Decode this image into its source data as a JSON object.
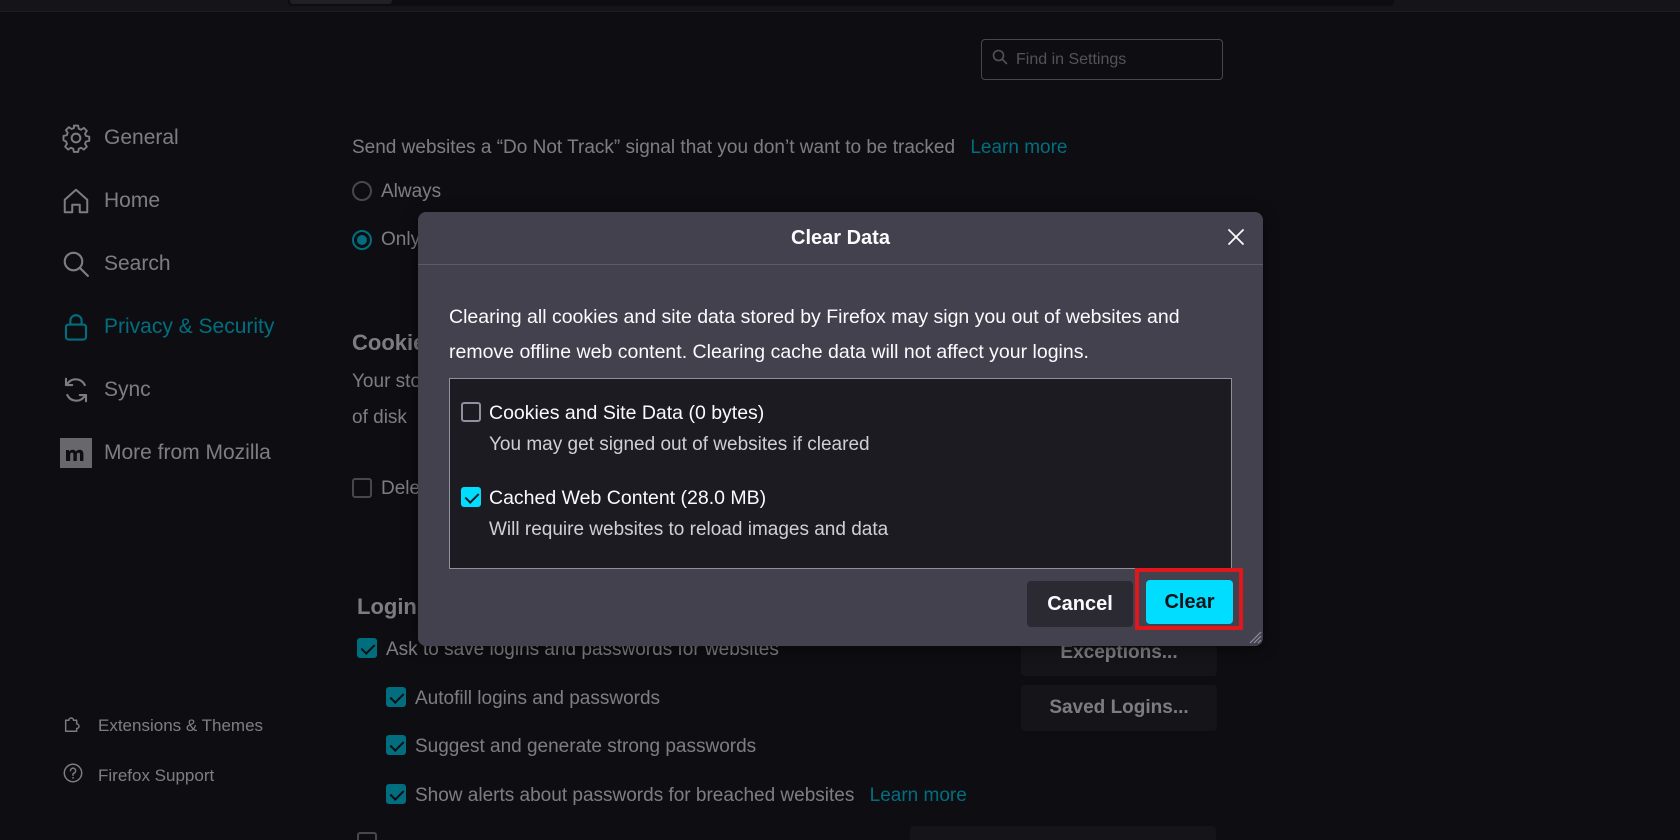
{
  "search": {
    "placeholder": "Find in Settings"
  },
  "sidebar": {
    "items": [
      {
        "label": "General",
        "icon": "gear-icon"
      },
      {
        "label": "Home",
        "icon": "home-icon"
      },
      {
        "label": "Search",
        "icon": "search-icon"
      },
      {
        "label": "Privacy & Security",
        "icon": "lock-icon",
        "active": true
      },
      {
        "label": "Sync",
        "icon": "sync-icon"
      },
      {
        "label": "More from Mozilla",
        "icon": "mozilla-icon"
      }
    ],
    "footer": [
      {
        "label": "Extensions & Themes",
        "icon": "puzzle-icon"
      },
      {
        "label": "Firefox Support",
        "icon": "help-icon"
      }
    ]
  },
  "main": {
    "dnt_text": "Send websites a “Do Not Track” signal that you don’t want to be tracked",
    "dnt_learn_more": "Learn more",
    "dnt_always": "Always",
    "dnt_only": "Only",
    "cookies_heading": "Cookie",
    "cookies_text1": "Your sto",
    "cookies_text2": "of disk",
    "delete_label": "Dele",
    "logins_heading": "Logins",
    "ask_save": "Ask to save logins and passwords for websites",
    "autofill": "Autofill logins and passwords",
    "suggest": "Suggest and generate strong passwords",
    "alerts": "Show alerts about passwords for breached websites",
    "alerts_learn_more": "Learn more",
    "exceptions": "Exceptions...",
    "saved_logins": "Saved Logins..."
  },
  "dialog": {
    "title": "Clear Data",
    "description": "Clearing all cookies and site data stored by Firefox may sign you out of websites and remove offline web content. Clearing cache data will not affect your logins.",
    "items": [
      {
        "title": "Cookies and Site Data (0 bytes)",
        "subtitle": "You may get signed out of websites if cleared",
        "checked": false
      },
      {
        "title": "Cached Web Content (28.0 MB)",
        "subtitle": "Will require websites to reload images and data",
        "checked": true
      }
    ],
    "cancel_label": "Cancel",
    "clear_label": "Clear"
  },
  "colors": {
    "accent": "#00ddff",
    "highlight": "#e0181c",
    "background": "#1c1b22",
    "dialog_bg": "#42414d"
  }
}
